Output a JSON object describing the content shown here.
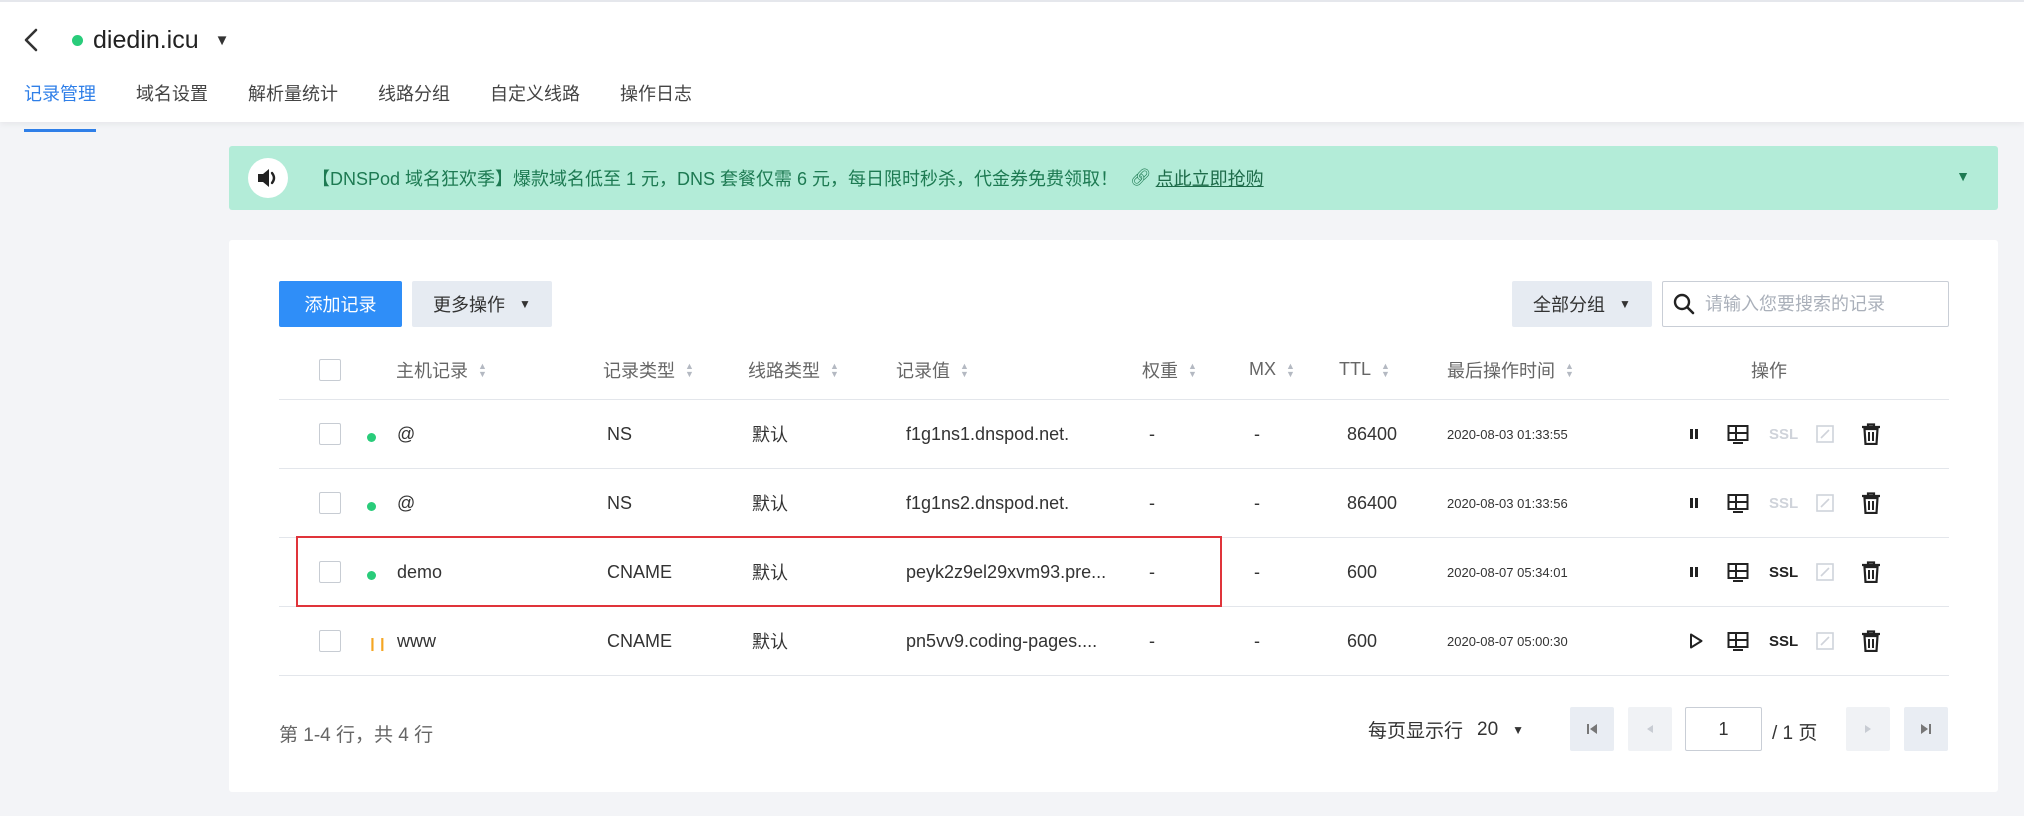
{
  "header": {
    "domain": "diedin.icu",
    "tabs": [
      {
        "label": "记录管理",
        "active": true
      },
      {
        "label": "域名设置",
        "active": false
      },
      {
        "label": "解析量统计",
        "active": false
      },
      {
        "label": "线路分组",
        "active": false
      },
      {
        "label": "自定义线路",
        "active": false
      },
      {
        "label": "操作日志",
        "active": false
      }
    ]
  },
  "banner": {
    "text": "【DNSPod 域名狂欢季】爆款域名低至 1 元，DNS 套餐仅需 6 元，每日限时秒杀，代金券免费领取！",
    "link_text": "点此立即抢购"
  },
  "toolbar": {
    "add_label": "添加记录",
    "more_label": "更多操作",
    "group_label": "全部分组",
    "search_placeholder": "请输入您要搜索的记录"
  },
  "table": {
    "headers": {
      "host": "主机记录",
      "type": "记录类型",
      "line": "线路类型",
      "value": "记录值",
      "weight": "权重",
      "mx": "MX",
      "ttl": "TTL",
      "time": "最后操作时间",
      "ops": "操作"
    },
    "rows": [
      {
        "host": "@",
        "type": "NS",
        "line": "默认",
        "value": "f1g1ns1.dnspod.net.",
        "weight": "-",
        "mx": "-",
        "ttl": "86400",
        "time": "2020-08-03 01:33:55",
        "status": "enabled",
        "ssl": "SSL",
        "ssl_enabled": false
      },
      {
        "host": "@",
        "type": "NS",
        "line": "默认",
        "value": "f1g1ns2.dnspod.net.",
        "weight": "-",
        "mx": "-",
        "ttl": "86400",
        "time": "2020-08-03 01:33:56",
        "status": "enabled",
        "ssl": "SSL",
        "ssl_enabled": false
      },
      {
        "host": "demo",
        "type": "CNAME",
        "line": "默认",
        "value": "peyk2z9el29xvm93.pre...",
        "weight": "-",
        "mx": "-",
        "ttl": "600",
        "time": "2020-08-07 05:34:01",
        "status": "enabled",
        "ssl": "SSL",
        "ssl_enabled": true
      },
      {
        "host": "www",
        "type": "CNAME",
        "line": "默认",
        "value": "pn5vv9.coding-pages....",
        "weight": "-",
        "mx": "-",
        "ttl": "600",
        "time": "2020-08-07 05:00:30",
        "status": "paused",
        "ssl": "SSL",
        "ssl_enabled": true
      }
    ]
  },
  "footer": {
    "summary": "第 1-4 行，共 4 行",
    "page_size_label": "每页显示行",
    "page_size": "20",
    "current_page": "1",
    "total_pages": "/ 1 页"
  },
  "colors": {
    "accent": "#2f8ef8",
    "banner_bg": "#b3ecd8",
    "status_green": "#29cc7a",
    "status_paused": "#f5a623",
    "highlight": "#e0343a"
  }
}
